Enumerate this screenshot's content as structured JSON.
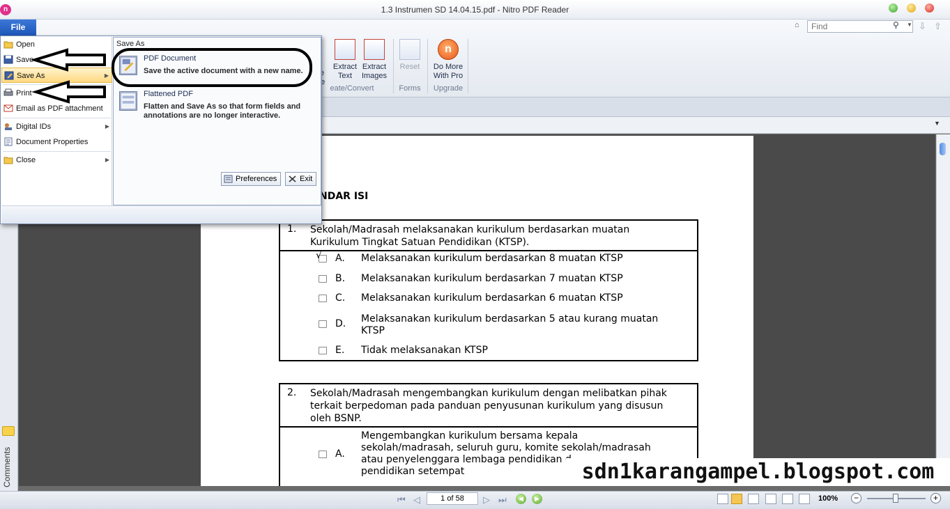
{
  "app": {
    "logo_letter": "n",
    "title": "1.3 Instrumen SD 14.04.15.pdf - Nitro PDF Reader"
  },
  "search": {
    "placeholder": "Find"
  },
  "ribbon": {
    "buttons": [
      {
        "label1": "e",
        "label2": "le"
      },
      {
        "label1": "Extract",
        "label2": "Text"
      },
      {
        "label1": "Extract",
        "label2": "Images"
      },
      {
        "label1": "Reset",
        "label2": ""
      },
      {
        "label1": "Do More",
        "label2": "With Pro"
      }
    ],
    "groups": [
      "eate/Convert",
      "Forms",
      "Upgrade"
    ]
  },
  "file_menu": {
    "tab_label": "File",
    "items": [
      {
        "label": "Open",
        "icon": "folder-open-icon"
      },
      {
        "label": "Save",
        "icon": "floppy-disk-icon"
      },
      {
        "label": "Save As",
        "icon": "save-as-icon"
      },
      {
        "label": "Print",
        "icon": "printer-icon"
      },
      {
        "label": "Email as PDF attachment",
        "icon": "email-pdf-icon"
      },
      {
        "label": "Digital IDs",
        "icon": "digital-id-icon"
      },
      {
        "label": "Document Properties",
        "icon": "document-properties-icon"
      },
      {
        "label": "Close",
        "icon": "folder-close-icon"
      }
    ],
    "save_as_panel": {
      "title": "Save As",
      "options": [
        {
          "name": "PDF Document",
          "description": "Save the active document with a new name."
        },
        {
          "name": "Flattened PDF",
          "description": "Flatten and Save As so that form fields and annotations are no longer interactive."
        }
      ]
    },
    "preferences_label": "Preferences",
    "exit_label": "Exit"
  },
  "left_panel": {
    "comments_label": "Comments"
  },
  "document": {
    "section_title": "NDAR ISI",
    "questions": [
      {
        "number": "1.",
        "text_line1": "Sekolah/Madrasah melaksanakan kurikulum berdasarkan muatan",
        "text_line2": "Kurikulum Tingkat Satuan Pendidikan (KTSP).",
        "tick": "√",
        "options": [
          {
            "letter": "A.",
            "text": "Melaksanakan kurikulum berdasarkan 8 muatan KTSP",
            "checked": true
          },
          {
            "letter": "B.",
            "text": "Melaksanakan kurikulum berdasarkan 7 muatan KTSP",
            "checked": false
          },
          {
            "letter": "C.",
            "text": "Melaksanakan kurikulum berdasarkan 6 muatan KTSP",
            "checked": false
          },
          {
            "letter": "D.",
            "text_line1": "Melaksanakan kurikulum berdasarkan 5 atau kurang muatan",
            "text_line2": "KTSP",
            "checked": false
          },
          {
            "letter": "E.",
            "text": "Tidak melaksanakan KTSP",
            "checked": false
          }
        ]
      },
      {
        "number": "2.",
        "text_line1": "Sekolah/Madrasah mengembangkan kurikulum dengan melibatkan pihak",
        "text_line2": "terkait berpedoman pada panduan penyusunan kurikulum yang disusun",
        "text_line3": "oleh BSNP.",
        "options": [
          {
            "letter": "A.",
            "text_line1": "Mengembangkan kurikulum bersama kepala",
            "text_line2": "sekolah/madrasah, seluruh guru, komite sekolah/madrasah",
            "text_line3": "atau penyelenggara lembaga pendidikan d",
            "text_line4": "pendidikan setempat",
            "checked": false
          }
        ]
      }
    ]
  },
  "watermark": "sdn1karangampel.blogspot.com",
  "status_bar": {
    "page_indicator": "1 of 58",
    "zoom": "100%"
  },
  "annotations": {
    "arrows_point_to": [
      "Save",
      "Print"
    ],
    "ellipse_highlights": "PDF Document"
  }
}
